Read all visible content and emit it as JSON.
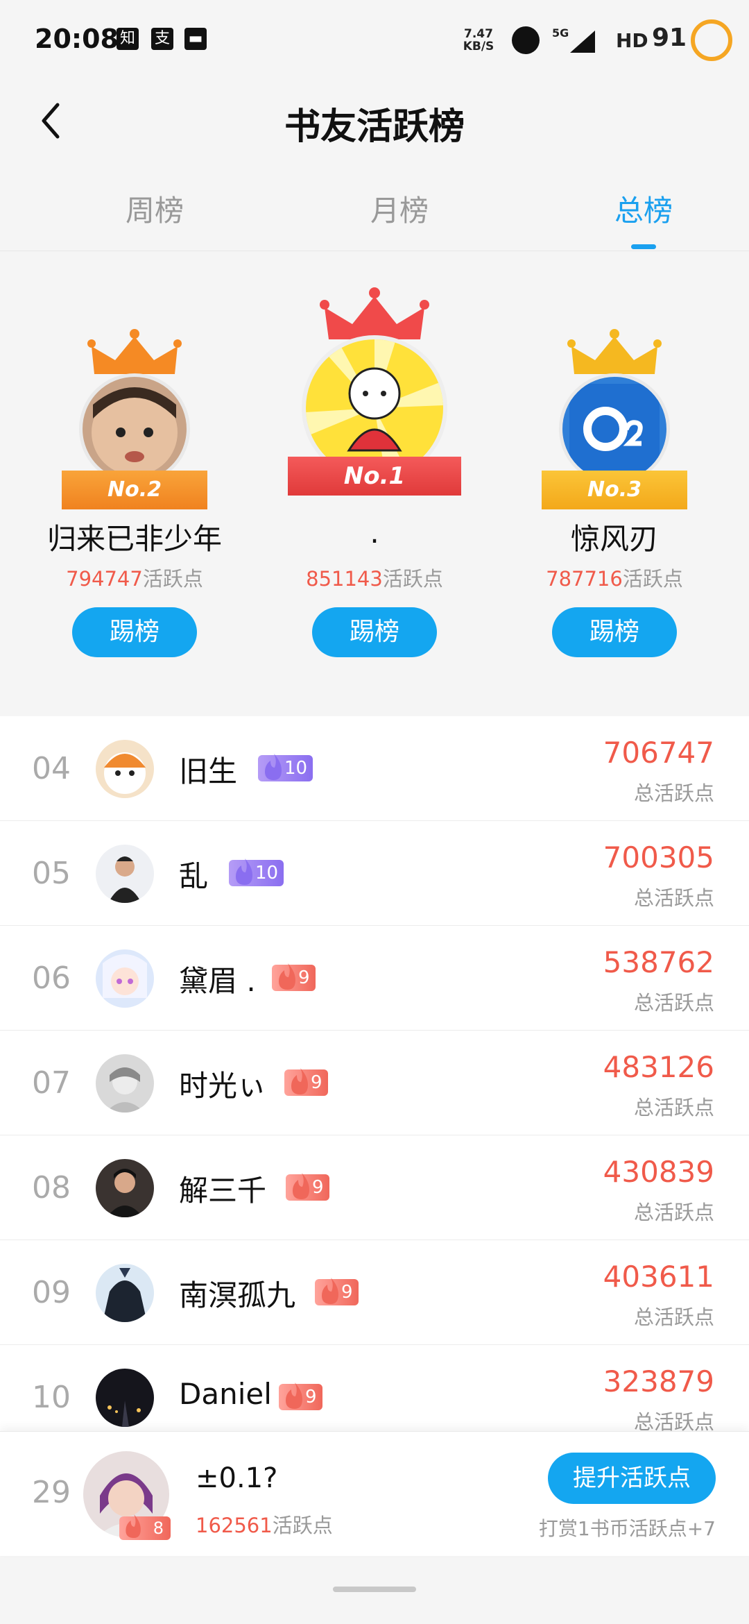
{
  "status_bar": {
    "time": "20:08",
    "app_icons": [
      "知",
      "支",
      "▬"
    ],
    "net_speed_value": "7.47",
    "net_speed_unit": "KB/S",
    "signal": "5G",
    "hd": "HD",
    "battery": "91"
  },
  "header": {
    "title": "书友活跃榜"
  },
  "tabs": [
    {
      "label": "周榜"
    },
    {
      "label": "月榜"
    },
    {
      "label": "总榜"
    }
  ],
  "active_tab": "总榜",
  "podium": [
    {
      "rank_label": "No.2",
      "name": "归来已非少年",
      "points": "794747",
      "points_suffix": "活跃点",
      "button": "踢榜",
      "crown_color": "#f58a24"
    },
    {
      "rank_label": "No.1",
      "name": ".",
      "points": "851143",
      "points_suffix": "活跃点",
      "button": "踢榜",
      "crown_color": "#f04a4a"
    },
    {
      "rank_label": "No.3",
      "name": "惊风刃",
      "points": "787716",
      "points_suffix": "活跃点",
      "button": "踢榜",
      "crown_color": "#f5b820"
    }
  ],
  "ranking": [
    {
      "rank": "04",
      "name": "旧生",
      "level": "10",
      "level_color": "purple",
      "score": "706747",
      "score_label": "总活跃点"
    },
    {
      "rank": "05",
      "name": "乱",
      "level": "10",
      "level_color": "purple",
      "score": "700305",
      "score_label": "总活跃点"
    },
    {
      "rank": "06",
      "name": "黛眉 .",
      "level": "9",
      "level_color": "red",
      "score": "538762",
      "score_label": "总活跃点"
    },
    {
      "rank": "07",
      "name": "时光ぃ",
      "level": "9",
      "level_color": "red",
      "score": "483126",
      "score_label": "总活跃点"
    },
    {
      "rank": "08",
      "name": "解三千",
      "level": "9",
      "level_color": "red",
      "score": "430839",
      "score_label": "总活跃点"
    },
    {
      "rank": "09",
      "name": "南溟孤九",
      "level": "9",
      "level_color": "red",
      "score": "403611",
      "score_label": "总活跃点"
    },
    {
      "rank": "10",
      "name": "Daniel",
      "level": "9",
      "level_color": "red",
      "score": "323879",
      "score_label": "总活跃点"
    }
  ],
  "me": {
    "rank": "29",
    "name": "±0.1?",
    "level": "8",
    "points": "162561",
    "points_suffix": "活跃点",
    "button": "提升活跃点",
    "tip": "打赏1书币活跃点+7"
  },
  "colors": {
    "accent": "#14a6f0",
    "score": "#f05a4a"
  }
}
